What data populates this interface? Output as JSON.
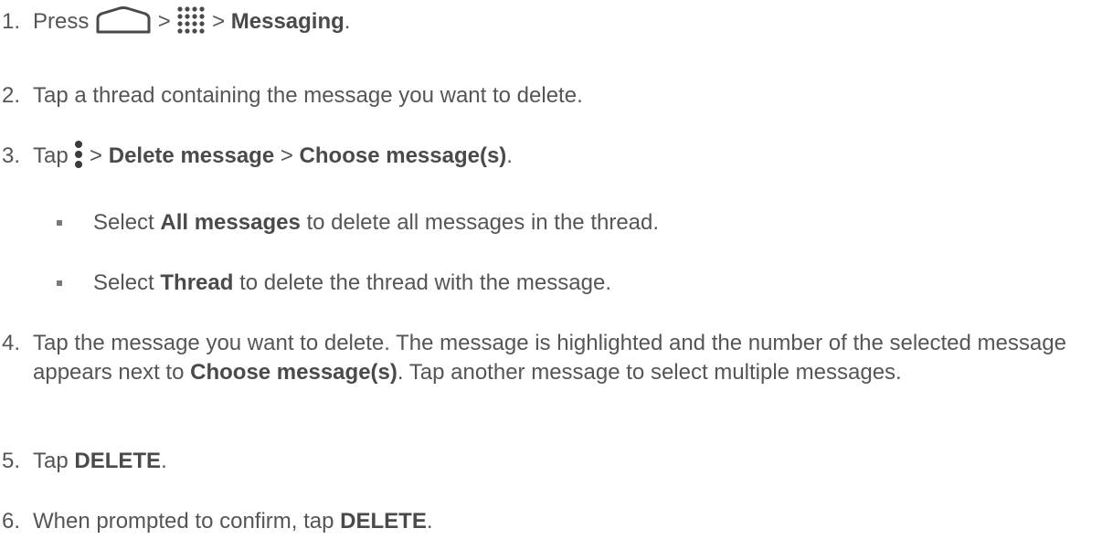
{
  "steps": {
    "s1": {
      "num": "1.",
      "press": "Press",
      "gt1": ">",
      "gt2": ">",
      "messaging": "Messaging",
      "end": "."
    },
    "s2": {
      "num": "2.",
      "text": "Tap a thread containing the message you want to delete."
    },
    "s3": {
      "num": "3.",
      "tap": "Tap",
      "gt1": ">",
      "delete_message": "Delete message",
      "gt2": ">",
      "choose": "Choose message(s)",
      "end": "."
    },
    "b1": {
      "select": "Select",
      "all_messages": "All messages",
      "rest": "to delete all messages in the thread."
    },
    "b2": {
      "select": "Select",
      "thread": "Thread",
      "rest": "to delete the thread with the message."
    },
    "s4": {
      "num": "4.",
      "t1": "Tap the message you want to delete. The message is highlighted and the number of the selected message appears next to",
      "choose": "Choose message(s)",
      "t2": ". Tap another message to select multiple messages."
    },
    "s5": {
      "num": "5.",
      "tap": "Tap",
      "delete": "DELETE",
      "end": "."
    },
    "s6": {
      "num": "6.",
      "text": "When prompted to confirm, tap",
      "delete": "DELETE",
      "end": "."
    }
  },
  "icons": {
    "home": "home-icon",
    "apps": "apps-grid-icon",
    "menu": "more-options-icon"
  }
}
